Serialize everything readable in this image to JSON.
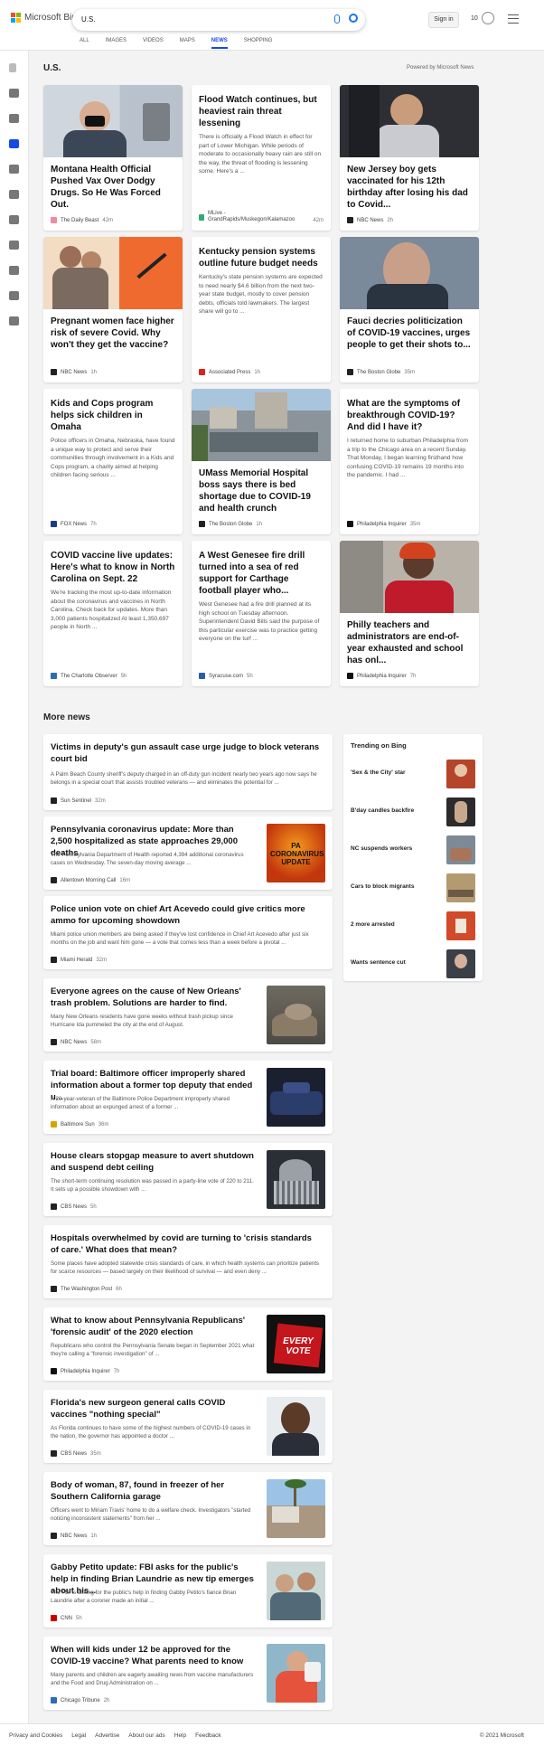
{
  "header": {
    "brand": "Microsoft Bing",
    "search_value": "U.S.",
    "signin_label": "Sign in",
    "rewards_count": "10",
    "tabs": [
      {
        "label": "ALL"
      },
      {
        "label": "IMAGES"
      },
      {
        "label": "VIDEOS"
      },
      {
        "label": "MAPS"
      },
      {
        "label": "NEWS",
        "active": true
      },
      {
        "label": "SHOPPING"
      }
    ]
  },
  "section": {
    "title": "U.S.",
    "powered_by": "Powered by Microsoft News"
  },
  "cards": [
    {
      "title": "Montana Health Official Pushed Vax Over Dodgy Drugs. So He Was Forced Out.",
      "source": "The Daily Beast",
      "time": "42m",
      "src_color": "#f08aa0",
      "image": "man-in-mask"
    },
    {
      "title": "Flood Watch continues, but heaviest rain threat lessening",
      "snippet": "There is officially a Flood Watch in effect for part of Lower Michigan. While periods of moderate to occasionally heavy rain are still on the way, the threat of flooding is lessening some. Here's a ...",
      "source": "MLive - GrandRapids/Muskegon/Kalamazoo",
      "time": "42m",
      "src_color": "#3a7"
    },
    {
      "title": "New Jersey boy gets vaccinated for his 12th birthday after losing his dad to Covid...",
      "source": "NBC News",
      "time": "2h",
      "src_color": "#222",
      "image": "boy-in-chair"
    },
    {
      "title": "Pregnant women face higher risk of severe Covid. Why won't they get the vaccine?",
      "source": "NBC News",
      "time": "1h",
      "src_color": "#222",
      "image": "family-syringe"
    },
    {
      "title": "Kentucky pension systems outline future budget needs",
      "snippet": "Kentucky's state pension systems are expected to need nearly $4.6 billion from the next two-year state budget, mostly to cover pension debts, officials told lawmakers. The largest share will go to ...",
      "source": "Associated Press",
      "time": "1h",
      "src_color": "#d22"
    },
    {
      "title": "Fauci decries politicization of COVID-19 vaccines, urges people to get their shots to...",
      "source": "The Boston Globe",
      "time": "35m",
      "src_color": "#222",
      "image": "fauci"
    },
    {
      "title": "Kids and Cops program helps sick children in Omaha",
      "snippet": "Police officers in Omaha, Nebraska, have found a unique way to protect and serve their communities through involvement in a Kids and Cops program, a charity aimed at helping children facing serious ...",
      "source": "FOX News",
      "time": "7h",
      "src_color": "#1a3a8a"
    },
    {
      "title": "UMass Memorial Hospital boss says there is bed shortage due to COVID-19 and health crunch",
      "source": "The Boston Globe",
      "time": "1h",
      "src_color": "#222",
      "image": "hospital-aerial"
    },
    {
      "title": "What are the symptoms of breakthrough COVID-19? And did I have it?",
      "snippet": "I returned home to suburban Philadelphia from a trip to the Chicago area on a recent Sunday. That Monday, I began learning firsthand how confusing COVID-19 remains 19 months into the pandemic. I had ...",
      "source": "Philadelphia Inquirer",
      "time": "35m",
      "src_color": "#111"
    },
    {
      "title": "COVID vaccine live updates: Here's what to know in North Carolina on Sept. 22",
      "snippet": "We're tracking the most up-to-date information about the coronavirus and vaccines in North Carolina. Check back for updates. More than 3,000 patients hospitalized At least 1,350,697 people in North ...",
      "source": "The Charlotte Observer",
      "time": "5h",
      "src_color": "#2a6db5"
    },
    {
      "title": "A West Genesee fire drill turned into a sea of red support for Carthage football player who...",
      "snippet": "West Genesee had a fire drill planned at its high school on Tuesday afternoon. Superintendent David Bills said the purpose of this particular exercise was to practice getting everyone on the turf ...",
      "source": "Syracuse.com",
      "time": "5h",
      "src_color": "#2a5ea8"
    },
    {
      "title": "Philly teachers and administrators are end-of-year exhausted and school has onl...",
      "source": "Philadelphia Inquirer",
      "time": "7h",
      "src_color": "#111",
      "image": "teacher-red-hair"
    }
  ],
  "more_news": {
    "title": "More news",
    "items": [
      {
        "title": "Victims in deputy's gun assault case urge judge to block veterans court bid",
        "snippet": "A Palm Beach County sheriff's deputy charged in an off-duty gun incident nearly two years ago now says he belongs in a special court that assists troubled veterans — and eliminates the potential for ...",
        "source": "Sun Sentinel",
        "time": "32m",
        "src_color": "#222"
      },
      {
        "title": "Pennsylvania coronavirus update: More than 2,500 hospitalized as state approaches 29,000 deaths",
        "snippet": "The Pennsylvania Department of Health reported 4,394 additional coronavirus cases on Wednesday. The seven-day moving average ...",
        "source": "Allentown Morning Call",
        "time": "16m",
        "src_color": "#222",
        "image": "pa-covid",
        "image_text": "PA CORONAVIRUS UPDATE"
      },
      {
        "title": "Police union vote on chief Art Acevedo could give critics more ammo for upcoming showdown",
        "snippet": "Miami police union members are being asked if they've lost confidence in Chief Art Acevedo after just six months on the job and want him gone — a vote that comes less than a week before a pivotal ...",
        "source": "Miami Herald",
        "time": "32m",
        "src_color": "#222"
      },
      {
        "title": "Everyone agrees on the cause of New Orleans' trash problem. Solutions are harder to find.",
        "snippet": "Many New Orleans residents have gone weeks without trash pickup since Hurricane Ida pummeled the city at the end of August.",
        "source": "NBC News",
        "time": "58m",
        "src_color": "#222",
        "image": "trash"
      },
      {
        "title": "Trial board: Baltimore officer improperly shared information about a former top deputy that ended u...",
        "snippet": "A 20-year-veteran of the Baltimore Police Department improperly shared information about an expunged arrest of a former ...",
        "source": "Baltimore Sun",
        "time": "36m",
        "src_color": "#d6a400",
        "image": "police-car"
      },
      {
        "title": "House clears stopgap measure to avert shutdown and suspend debt ceiling",
        "snippet": "The short-term continuing resolution was passed in a party-line vote of 220 to 211. It sets up a possible showdown with ...",
        "source": "CBS News",
        "time": "5h",
        "src_color": "#222",
        "image": "capitol"
      },
      {
        "title": "Hospitals overwhelmed by covid are turning to 'crisis standards of care.' What does that mean?",
        "snippet": "Some places have adopted statewide crisis standards of care, in which health systems can prioritize patients for scarce resources — based largely on their likelihood of survival — and even deny ...",
        "source": "The Washington Post",
        "time": "6h",
        "src_color": "#222"
      },
      {
        "title": "What to know about Pennsylvania Republicans' 'forensic audit' of the 2020 election",
        "snippet": "Republicans who control the Pennsylvania Senate began in September 2021 what they're calling a \"forensic investigation\" of ...",
        "source": "Philadelphia Inquirer",
        "time": "7h",
        "src_color": "#111",
        "image": "vote-signs",
        "image_text": "EVERY VOTE"
      },
      {
        "title": "Florida's new surgeon general calls COVID vaccines \"nothing special\"",
        "snippet": "As Florida continues to have some of the highest numbers of COVID-19 cases in the nation, the governor has appointed a doctor ...",
        "source": "CBS News",
        "time": "35m",
        "src_color": "#222",
        "image": "surgeon-general"
      },
      {
        "title": "Body of woman, 87, found in freezer of her Southern California garage",
        "snippet": "Officers went to Miriam Travis' home to do a welfare check. Investigators \"started noticing inconsistent statements\" from her ...",
        "source": "NBC News",
        "time": "1h",
        "src_color": "#222",
        "image": "house-palm"
      },
      {
        "title": "Gabby Petito update: FBI asks for the public's help in finding Brian Laundrie as new tip emerges about his...",
        "snippet": "The FBI is asking for the public's help in finding Gabby Petito's fiancé Brian Laundrie after a coroner made an initial ...",
        "source": "CNN",
        "time": "5h",
        "src_color": "#cc0000",
        "image": "couple"
      },
      {
        "title": "When will kids under 12 be approved for the COVID-19 vaccine? What parents need to know",
        "snippet": "Many parents and children are eagerly awaiting news from vaccine manufacturers and the Food and Drug Administration on ...",
        "source": "Chicago Tribune",
        "time": "2h",
        "src_color": "#2a6db5",
        "image": "vaccine-kid"
      }
    ]
  },
  "trending": {
    "title": "Trending on Bing",
    "items": [
      {
        "label": "'Sex & the City' star"
      },
      {
        "label": "B'day candles backfire"
      },
      {
        "label": "NC suspends workers"
      },
      {
        "label": "Cars to block migrants"
      },
      {
        "label": "2 more arrested"
      },
      {
        "label": "Wants sentence cut"
      }
    ]
  },
  "footer": {
    "links": [
      "Privacy and Cookies",
      "Legal",
      "Advertise",
      "About our ads",
      "Help",
      "Feedback"
    ],
    "copyright": "© 2021 Microsoft"
  },
  "colors": {
    "accent": "#174ae4",
    "brand_red": "#f25022",
    "brand_green": "#7fba00",
    "brand_blue": "#00a4ef",
    "brand_yellow": "#ffb900"
  }
}
